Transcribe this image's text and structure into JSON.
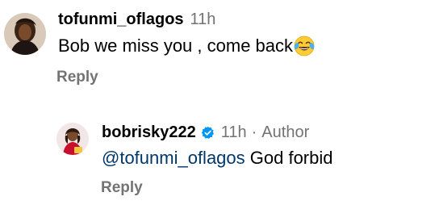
{
  "comments": [
    {
      "username": "tofunmi_oflagos",
      "time": "11h",
      "text": "Bob we miss you , come back",
      "emoji": "face-with-tears-of-joy",
      "reply_label": "Reply"
    }
  ],
  "replies": [
    {
      "username": "bobrisky222",
      "verified": true,
      "time": "11h",
      "separator": "·",
      "badge": "Author",
      "mention": "@tofunmi_oflagos",
      "text": " God forbid",
      "reply_label": "Reply"
    }
  ],
  "colors": {
    "secondary_text": "#737373",
    "mention": "#00376b",
    "verified_badge": "#0095f6"
  }
}
